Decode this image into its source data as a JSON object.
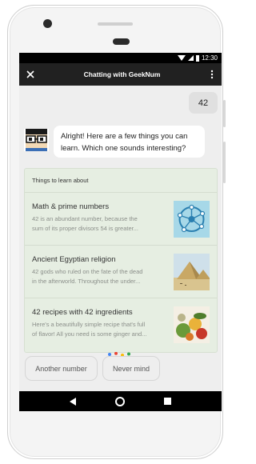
{
  "status_bar": {
    "time": "12:30"
  },
  "app_bar": {
    "title": "Chatting with GeekNum",
    "close_icon": "close-icon",
    "more_icon": "more-vert-icon"
  },
  "chat": {
    "user_message": "42",
    "bot_message": "Alright! Here are a few things you can learn. Which one sounds interesting?"
  },
  "card": {
    "header": "Things to learn about",
    "items": [
      {
        "title": "Math & prime numbers",
        "desc_line1": "42 is an abundant number, because the",
        "desc_line2": "sum of its proper divisors 54 is greater...",
        "thumb": "network-diagram"
      },
      {
        "title": "Ancient Egyptian religion",
        "desc_line1": "42 gods who ruled on the fate of the dead",
        "desc_line2": "in the afterworld. Throughout the under...",
        "thumb": "pyramids"
      },
      {
        "title": "42 recipes with 42 ingredients",
        "desc_line1": "Here's a beautifully simple recipe that's full",
        "desc_line2": "of flavor! All you need is some ginger and...",
        "thumb": "vegetables"
      }
    ]
  },
  "suggestions": [
    "Another number",
    "Never mind"
  ],
  "colors": {
    "app_bar": "#212121",
    "card_bg": "#e6eee2",
    "assistant_dots": [
      "#4285f4",
      "#ea4335",
      "#fbbc05",
      "#34a853"
    ]
  }
}
